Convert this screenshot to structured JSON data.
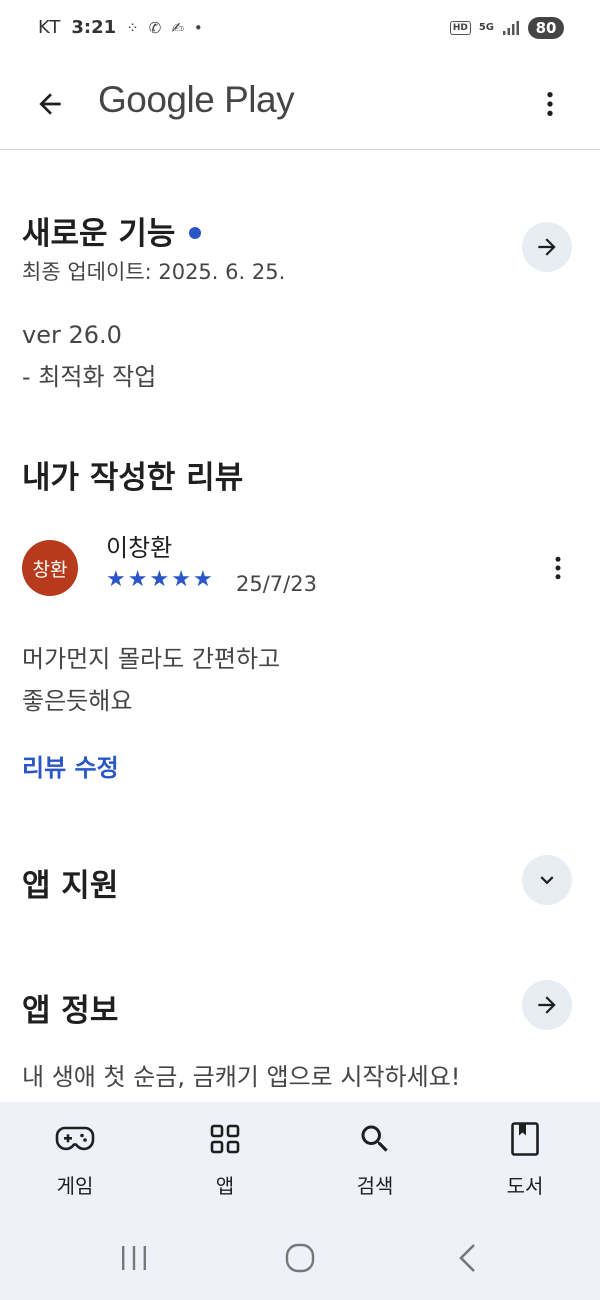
{
  "status_bar": {
    "carrier": "KT",
    "time": "3:21",
    "hd": "HD",
    "network": "5G",
    "battery": "80"
  },
  "app_bar": {
    "title": "Google Play"
  },
  "whats_new": {
    "title": "새로운 기능",
    "last_updated": "최종 업데이트: 2025. 6. 25.",
    "notes": [
      "ver 26.0",
      "- 최적화 작업"
    ]
  },
  "my_review": {
    "title": "내가 작성한 리뷰",
    "avatar_text": "창환",
    "reviewer": "이창환",
    "rating": 5,
    "date": "25/7/23",
    "text_lines": [
      "머가먼지 몰라도 간편하고",
      "좋은듯해요"
    ],
    "edit_label": "리뷰 수정"
  },
  "app_support": {
    "title": "앱 지원"
  },
  "app_info": {
    "title": "앱 정보",
    "description": "내 생애 첫 순금, 금캐기 앱으로 시작하세요!"
  },
  "bottom_nav": [
    {
      "label": "게임",
      "icon": "gamepad-icon"
    },
    {
      "label": "앱",
      "icon": "apps-grid-icon"
    },
    {
      "label": "검색",
      "icon": "search-icon"
    },
    {
      "label": "도서",
      "icon": "book-icon"
    }
  ],
  "colors": {
    "accent": "#2a56c6",
    "avatar": "#b63a1b",
    "nav_background": "#eef1f8"
  }
}
